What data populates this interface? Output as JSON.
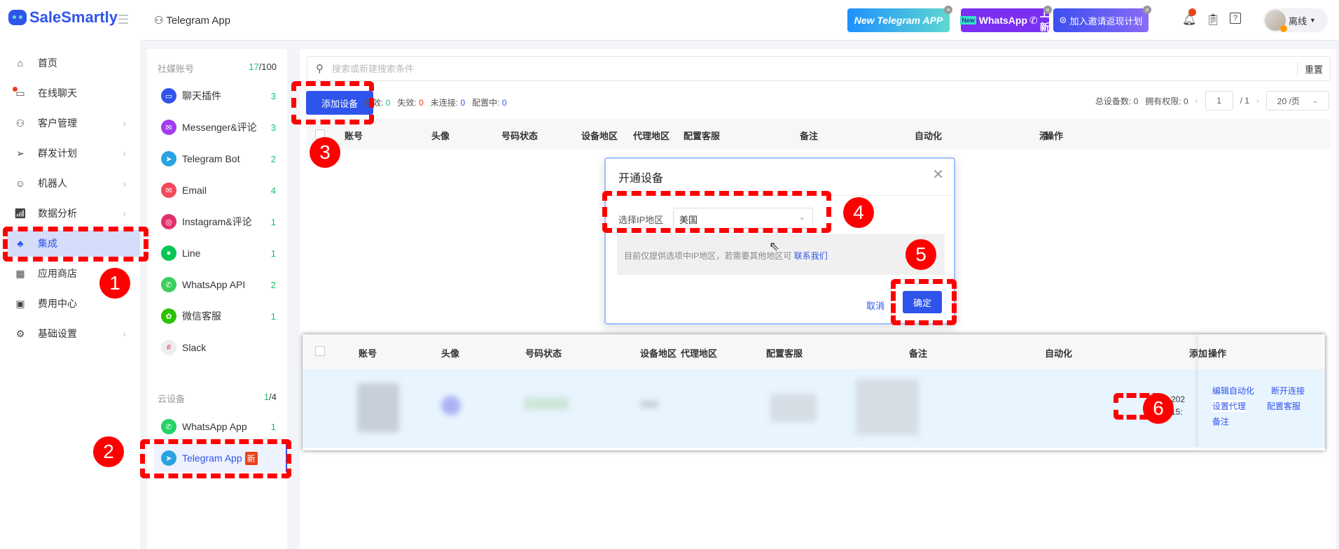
{
  "app": {
    "logo": "SaleSmartly",
    "breadcrumb": "Telegram App"
  },
  "banners": {
    "telegram": "New Telegram APP",
    "whatsapp_new": "New",
    "whatsapp": "WhatsApp",
    "whatsapp_suffix": "上新",
    "invite": "加入邀请返现计划"
  },
  "user": {
    "status": "离线"
  },
  "sidebar": {
    "items": [
      {
        "label": "首页",
        "icon": "home-icon"
      },
      {
        "label": "在线聊天",
        "icon": "chat-icon"
      },
      {
        "label": "客户管理",
        "icon": "users-icon"
      },
      {
        "label": "群发计划",
        "icon": "send-icon"
      },
      {
        "label": "机器人",
        "icon": "robot-icon"
      },
      {
        "label": "数据分析",
        "icon": "chart-icon"
      },
      {
        "label": "集成",
        "icon": "integration-icon"
      },
      {
        "label": "应用商店",
        "icon": "apps-icon"
      },
      {
        "label": "费用中心",
        "icon": "wallet-icon"
      },
      {
        "label": "基础设置",
        "icon": "gear-icon"
      }
    ]
  },
  "channels": {
    "social_title": "社媒账号",
    "social_used": "17",
    "social_total": "/100",
    "social": [
      {
        "label": "聊天插件",
        "count": "3",
        "color": "#2f54eb"
      },
      {
        "label": "Messenger&评论",
        "count": "3",
        "color": "#a33cf0"
      },
      {
        "label": "Telegram Bot",
        "count": "2",
        "color": "#2aa3e0"
      },
      {
        "label": "Email",
        "count": "4",
        "color": "#f2495c"
      },
      {
        "label": "Instagram&评论",
        "count": "1",
        "color": "#e1306c"
      },
      {
        "label": "Line",
        "count": "1",
        "color": "#06c755"
      },
      {
        "label": "WhatsApp API",
        "count": "2",
        "color": "#3ccf5e"
      },
      {
        "label": "微信客服",
        "count": "1",
        "color": "#2dc100"
      },
      {
        "label": "Slack",
        "count": "",
        "color": "#eee"
      }
    ],
    "cloud_title": "云设备",
    "cloud_used": "1",
    "cloud_total": "/4",
    "cloud": [
      {
        "label": "WhatsApp App",
        "count": "1"
      },
      {
        "label": "Telegram App",
        "badge": "新"
      }
    ]
  },
  "main": {
    "search_placeholder": "搜索或新建搜索条件",
    "reset": "重置",
    "add_device": "添加设备",
    "stats": [
      {
        "label": "有效:",
        "value": "0"
      },
      {
        "label": "失效:",
        "value": "0"
      },
      {
        "label": "未连接:",
        "value": "0"
      },
      {
        "label": "配置中:",
        "value": "0"
      }
    ],
    "total_label": "总设备数:",
    "total": "0",
    "perm_label": "拥有权限:",
    "perm": "0",
    "page": "1",
    "pages": "/ 1",
    "page_size": "20 /页",
    "columns": [
      "账号",
      "头像",
      "号码状态",
      "设备地区",
      "代理地区",
      "配置客服",
      "备注",
      "自动化",
      "添",
      "操作"
    ]
  },
  "modal": {
    "title": "开通设备",
    "ip_label": "选择IP地区",
    "ip_value": "美国",
    "tip": "目前仅提供选项中IP地区，若需要其他地区可",
    "tip_link": "联系我们",
    "cancel": "取消",
    "ok": "确定"
  },
  "table2": {
    "columns": [
      "账号",
      "头像",
      "号码状态",
      "设备地区",
      "代理地区",
      "配置客服",
      "备注",
      "自动化",
      "添加",
      "操作"
    ],
    "date_partial": "202",
    "time_partial": "15:",
    "actions": [
      "编辑自动化",
      "断开连接",
      "设置代理",
      "配置客服",
      "备注"
    ]
  },
  "annotations": [
    "1",
    "2",
    "3",
    "4",
    "5",
    "6"
  ]
}
